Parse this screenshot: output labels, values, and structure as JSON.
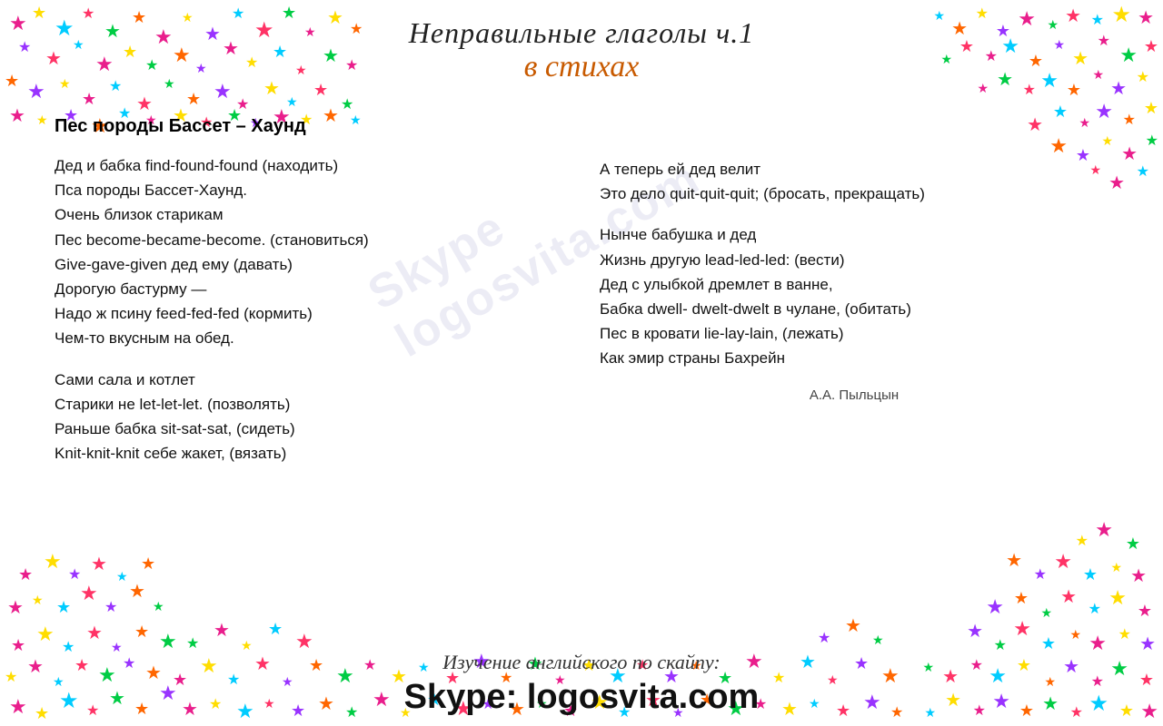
{
  "page": {
    "background": "#ffffff"
  },
  "title": {
    "main": "Неправильные глаголы  ч.1",
    "sub": "в стихах"
  },
  "poem": {
    "heading": "Пес породы Бассет – Хаунд",
    "left_stanzas": [
      {
        "lines": [
          "Дед и бабка find-found-found (находить)",
          "Пса породы Бассет-Хаунд.",
          "Очень близок старикам",
          "Пес become-became-become. (становиться)",
          "Give-gave-given дед ему (давать)",
          "Дорогую бастурму —",
          "Надо ж псину feed-fed-fed (кормить)",
          "Чем-то вкусным на обед."
        ]
      },
      {
        "lines": [
          "Сами сала и котлет",
          "Старики не let-let-let. (позволять)",
          "Раньше бабка sit-sat-sat, (сидеть)",
          "Knit-knit-knit себе жакет, (вязать)"
        ]
      }
    ],
    "right_stanzas": [
      {
        "lines": [
          "А теперь ей дед велит",
          "Это дело quit-quit-quit; (бросать, прекращать)"
        ]
      },
      {
        "lines": [
          "Нынче бабушка и дед",
          "Жизнь другую lead-led-led: (вести)",
          "Дед с улыбкой дремлет в ванне,",
          "Бабка dwell- dwelt-dwelt в чулане, (обитать)",
          "Пес в кровати lie-lay-lain, (лежать)",
          "Как эмир страны Бахрейн"
        ]
      }
    ],
    "author": "А.А. Пыльцын"
  },
  "watermark": {
    "line1": "Skype",
    "line2": "logosvita.com"
  },
  "footer": {
    "tagline": "Изучение английского по скайпу:",
    "skype": "Skype: logosvita.com"
  },
  "stars": {
    "colors": [
      "#e91e8c",
      "#ff3366",
      "#ffdd00",
      "#00ccff",
      "#00cc44",
      "#ff6600",
      "#9933ff",
      "#ff99cc"
    ],
    "icon": "★"
  }
}
